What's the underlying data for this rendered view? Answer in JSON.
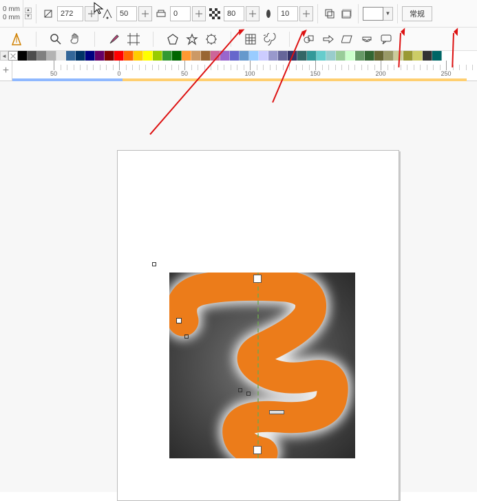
{
  "units": {
    "line1": "0 mm",
    "line2": "0 mm"
  },
  "toolbar": {
    "nib_size": "272",
    "tilt": "50",
    "bearing": "0",
    "opacity": "80",
    "feather": "10",
    "mode_label": "常规"
  },
  "color_swatch": "#ffffff",
  "ruler": {
    "labels": [
      "50",
      "0",
      "50",
      "100",
      "150",
      "200",
      "250"
    ]
  },
  "palette": [
    "#000000",
    "#4d4d4d",
    "#808080",
    "#b3b3b3",
    "#e6e6e6",
    "#336699",
    "#003366",
    "#000080",
    "#660066",
    "#800000",
    "#ff0000",
    "#ff6600",
    "#ffcc00",
    "#ffff00",
    "#99cc00",
    "#339933",
    "#006600",
    "#ff9933",
    "#cc9966",
    "#996633",
    "#cc6699",
    "#9966cc",
    "#6666cc",
    "#6699cc",
    "#99ccff",
    "#ccccff",
    "#9999cc",
    "#666699",
    "#333366",
    "#336666",
    "#339999",
    "#66cccc",
    "#99cccc",
    "#99cc99",
    "#ccffcc",
    "#669966",
    "#336633",
    "#666633",
    "#999966",
    "#cccc99",
    "#999933",
    "#cccc66",
    "#333333",
    "#006666"
  ],
  "icons": {
    "alignment": "alignment-icon",
    "zoom": "zoom-icon",
    "pan": "pan-icon",
    "color-picker": "color-picker-icon",
    "crop": "crop-guides-icon",
    "polygon": "polygon-icon",
    "star": "star-icon",
    "complex-star": "complex-star-icon",
    "table": "table-icon",
    "spiral": "spiral-icon",
    "connector": "connector-icon",
    "dimension": "dimension-icon",
    "parallel": "parallel-dimension-icon",
    "callout": "callout-icon"
  }
}
